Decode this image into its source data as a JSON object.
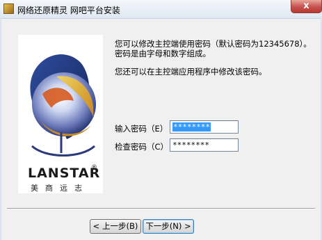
{
  "window": {
    "title": "网络还原精灵 网吧平台安装",
    "close_label": "x"
  },
  "logo": {
    "brand": "LANSTAR",
    "registered": "®",
    "chinese": "美商远志"
  },
  "content": {
    "description": "您可以修改主控端使用密码（默认密码为12345678）。密码是由字母和数字组成。",
    "note": "您还可以在主控端应用程序中修改该密码。"
  },
  "form": {
    "password_label": "输入密码（E）",
    "password_value": "********",
    "confirm_label": "检查密码（C）",
    "confirm_value": "********"
  },
  "buttons": {
    "back": "< 上一步(B)",
    "next": "下一步(N) >"
  }
}
